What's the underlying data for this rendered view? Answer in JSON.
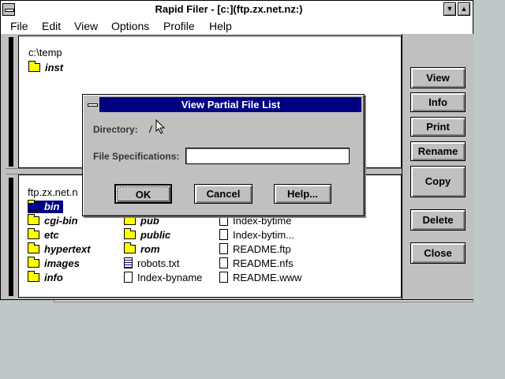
{
  "window": {
    "title": "Rapid Filer - [c:](ftp.zx.net.nz:)",
    "menu": [
      "File",
      "Edit",
      "View",
      "Options",
      "Profile",
      "Help"
    ]
  },
  "local_pane": {
    "path": "c:\\temp",
    "items": [
      {
        "name": "inst",
        "type": "folder"
      }
    ]
  },
  "remote_pane": {
    "path": "ftp.zx.net.nz",
    "path_visible": "ftp.zx.net.n",
    "columns": [
      [
        {
          "name": "bin",
          "type": "folder",
          "selected": true
        },
        {
          "name": "cgi-bin",
          "type": "folder"
        },
        {
          "name": "etc",
          "type": "folder"
        },
        {
          "name": "hypertext",
          "type": "folder"
        },
        {
          "name": "images",
          "type": "folder"
        },
        {
          "name": "info",
          "type": "folder"
        }
      ],
      [
        {
          "name": "pub",
          "type": "folder"
        },
        {
          "name": "public",
          "type": "folder"
        },
        {
          "name": "rom",
          "type": "folder"
        },
        {
          "name": "robots.txt",
          "type": "text"
        },
        {
          "name": "Index-byname",
          "type": "file"
        }
      ],
      [
        {
          "name": "Index-bytime",
          "type": "file"
        },
        {
          "name": "Index-bytim...",
          "type": "file"
        },
        {
          "name": "README.ftp",
          "type": "file"
        },
        {
          "name": "README.nfs",
          "type": "file"
        },
        {
          "name": "README.www",
          "type": "file"
        }
      ]
    ]
  },
  "side_buttons": [
    "View",
    "Info",
    "Print",
    "Rename",
    "Copy",
    "Delete",
    "Close"
  ],
  "dialog": {
    "title": "View Partial File List",
    "directory_label": "Directory:",
    "directory_value": "/",
    "filespec_label": "File Specifications:",
    "filespec_value": "",
    "ok_label": "OK",
    "cancel_label": "Cancel",
    "help_label": "Help..."
  },
  "colors": {
    "desktop": "#c0c7c8",
    "dialog_title": "#000080",
    "folder": "#ffff00"
  }
}
